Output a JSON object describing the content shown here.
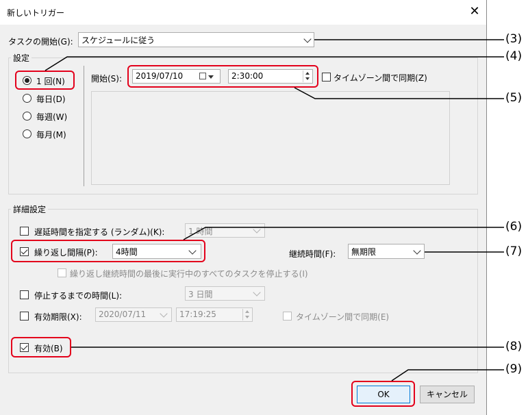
{
  "window": {
    "title": "新しいトリガー",
    "close": "✕"
  },
  "task_start": {
    "label": "タスクの開始(G):",
    "value": "スケジュールに従う"
  },
  "settings": {
    "legend": "設定",
    "schedule": [
      {
        "label": "1 回(N)",
        "selected": true
      },
      {
        "label": "毎日(D)",
        "selected": false
      },
      {
        "label": "毎週(W)",
        "selected": false
      },
      {
        "label": "毎月(M)",
        "selected": false
      }
    ],
    "start_label": "開始(S):",
    "start_date": "2019/07/10",
    "start_time": "2:30:00",
    "tz_sync": "タイムゾーン間で同期(Z)"
  },
  "advanced": {
    "legend": "詳細設定",
    "delay": {
      "label": "遅延時間を指定する (ランダム)(K):",
      "value": "1 時間",
      "checked": false
    },
    "repeat": {
      "label": "繰り返し間隔(P):",
      "value": "4時間",
      "checked": true
    },
    "duration": {
      "label": "継続時間(F):",
      "value": "無期限"
    },
    "stop_all": {
      "label": "繰り返し継続時間の最後に実行中のすべてのタスクを停止する(I)",
      "checked": false
    },
    "stop_after": {
      "label": "停止するまでの時間(L):",
      "value": "3 日間",
      "checked": false
    },
    "expire": {
      "label": "有効期限(X):",
      "date": "2020/07/11",
      "time": "17:19:25",
      "checked": false,
      "tz_sync": "タイムゾーン間で同期(E)"
    },
    "enabled": {
      "label": "有効(B)",
      "checked": true
    }
  },
  "buttons": {
    "ok": "OK",
    "cancel": "キャンセル"
  },
  "callouts": [
    "(3)",
    "(4)",
    "(5)",
    "(6)",
    "(7)",
    "(8)",
    "(9)"
  ],
  "colors": {
    "highlight": "#e3001b",
    "dialog_bg": "#f0f0f0"
  }
}
